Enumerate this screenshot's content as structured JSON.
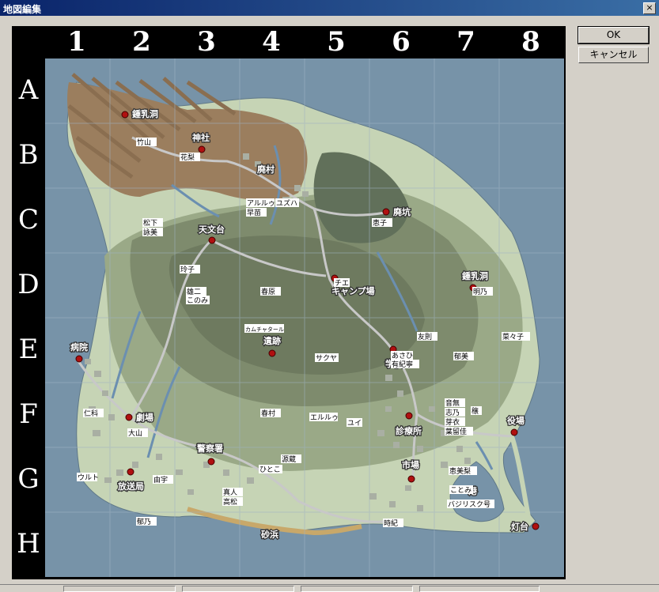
{
  "window": {
    "title": "地図編集",
    "close_glyph": "×"
  },
  "buttons": {
    "ok": "OK",
    "cancel": "キャンセル"
  },
  "grid": {
    "columns": [
      "1",
      "2",
      "3",
      "4",
      "5",
      "6",
      "7",
      "8"
    ],
    "rows": [
      "A",
      "B",
      "C",
      "D",
      "E",
      "F",
      "G",
      "H"
    ]
  },
  "locations": [
    {
      "id": "shonyudo-north",
      "name": "鍾乳洞"
    },
    {
      "id": "jinja",
      "name": "神社"
    },
    {
      "id": "haison",
      "name": "廃村"
    },
    {
      "id": "haiko",
      "name": "廃坑"
    },
    {
      "id": "tenmondai",
      "name": "天文台"
    },
    {
      "id": "camp",
      "name": "キャンプ場"
    },
    {
      "id": "shonyudo-east",
      "name": "鍾乳洞"
    },
    {
      "id": "iseki",
      "name": "遺跡"
    },
    {
      "id": "byoin",
      "name": "病院"
    },
    {
      "id": "gakko",
      "name": "学校"
    },
    {
      "id": "gekijo",
      "name": "劇場"
    },
    {
      "id": "shinryojo",
      "name": "診療所"
    },
    {
      "id": "yakuba",
      "name": "役場"
    },
    {
      "id": "keisatsusho",
      "name": "警察署"
    },
    {
      "id": "ichiba",
      "name": "市場"
    },
    {
      "id": "hosokyoku",
      "name": "放送局"
    },
    {
      "id": "minato",
      "name": "港"
    },
    {
      "id": "todai",
      "name": "灯台"
    },
    {
      "id": "sunahama",
      "name": "砂浜"
    }
  ],
  "characters": [
    "竹山",
    "花梨",
    "アルルゥ",
    "ユズハ",
    "早苗",
    "恵子",
    "松下",
    "詠美",
    "玲子",
    "雄二",
    "このみ",
    "春原",
    "チエ",
    "明乃",
    "カムチャタール",
    "友則",
    "菜々子",
    "あさひ",
    "有紀寧",
    "郁美",
    "サクヤ",
    "仁科",
    "音無",
    "志乃",
    "芽衣",
    "葉留佳",
    "穣",
    "大山",
    "春村",
    "エルルゥ",
    "ユイ",
    "源蔵",
    "ひとこ",
    "恵美梨",
    "ウルト",
    "由宇",
    "真人",
    "高松",
    "ことみ",
    "バジリスク号",
    "郁乃",
    "時紀"
  ],
  "colors": {
    "sea": "#7793a8",
    "grid_line": "#9fb3c4",
    "lowland": "#c6d4b5",
    "plain": "#9aa987",
    "forest": "#6e7a5f",
    "mountain": "#9b7e5e",
    "beach": "#c8a86a",
    "road": "#c8c8c8",
    "river": "#6b8fb0",
    "marker": "#b01010",
    "titlebar": "#0a246a"
  }
}
